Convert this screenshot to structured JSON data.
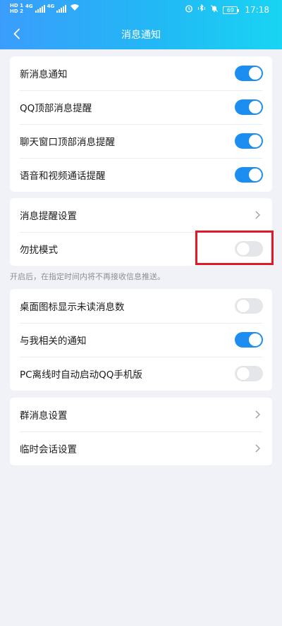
{
  "status_bar": {
    "sim1_label": "HD 1",
    "sim2_label": "HD 2",
    "network_gen_1": "4G",
    "network_gen_2": "4G",
    "battery_level": "69",
    "time": "17:18"
  },
  "header": {
    "title": "消息通知",
    "back_icon": "chevron-left-icon",
    "gradient": [
      "#3a9dfc",
      "#19d4f3"
    ]
  },
  "group1": {
    "items": [
      {
        "label": "新消息通知",
        "toggle_on": true
      },
      {
        "label": "QQ顶部消息提醒",
        "toggle_on": true
      },
      {
        "label": "聊天窗口顶部消息提醒",
        "toggle_on": true
      },
      {
        "label": "语音和视频通话提醒",
        "toggle_on": true
      }
    ]
  },
  "group2": {
    "items": [
      {
        "label": "消息提醒设置",
        "type": "link"
      },
      {
        "label": "勿扰模式",
        "toggle_on": false
      }
    ],
    "hint": "开启后，在指定时间内将不再接收信息推送。"
  },
  "group3": {
    "items": [
      {
        "label": "桌面图标显示未读消息数",
        "toggle_on": false
      },
      {
        "label": "与我相关的通知",
        "toggle_on": true
      },
      {
        "label": "PC离线时自动启动QQ手机版",
        "toggle_on": false
      }
    ]
  },
  "group4": {
    "items": [
      {
        "label": "群消息设置",
        "type": "link"
      },
      {
        "label": "临时会话设置",
        "type": "link"
      }
    ]
  },
  "colors": {
    "toggle_on": "#1d8ef1",
    "toggle_off": "#e5e6ea",
    "highlight": "#e01828",
    "page_bg": "#f1f2f7"
  }
}
